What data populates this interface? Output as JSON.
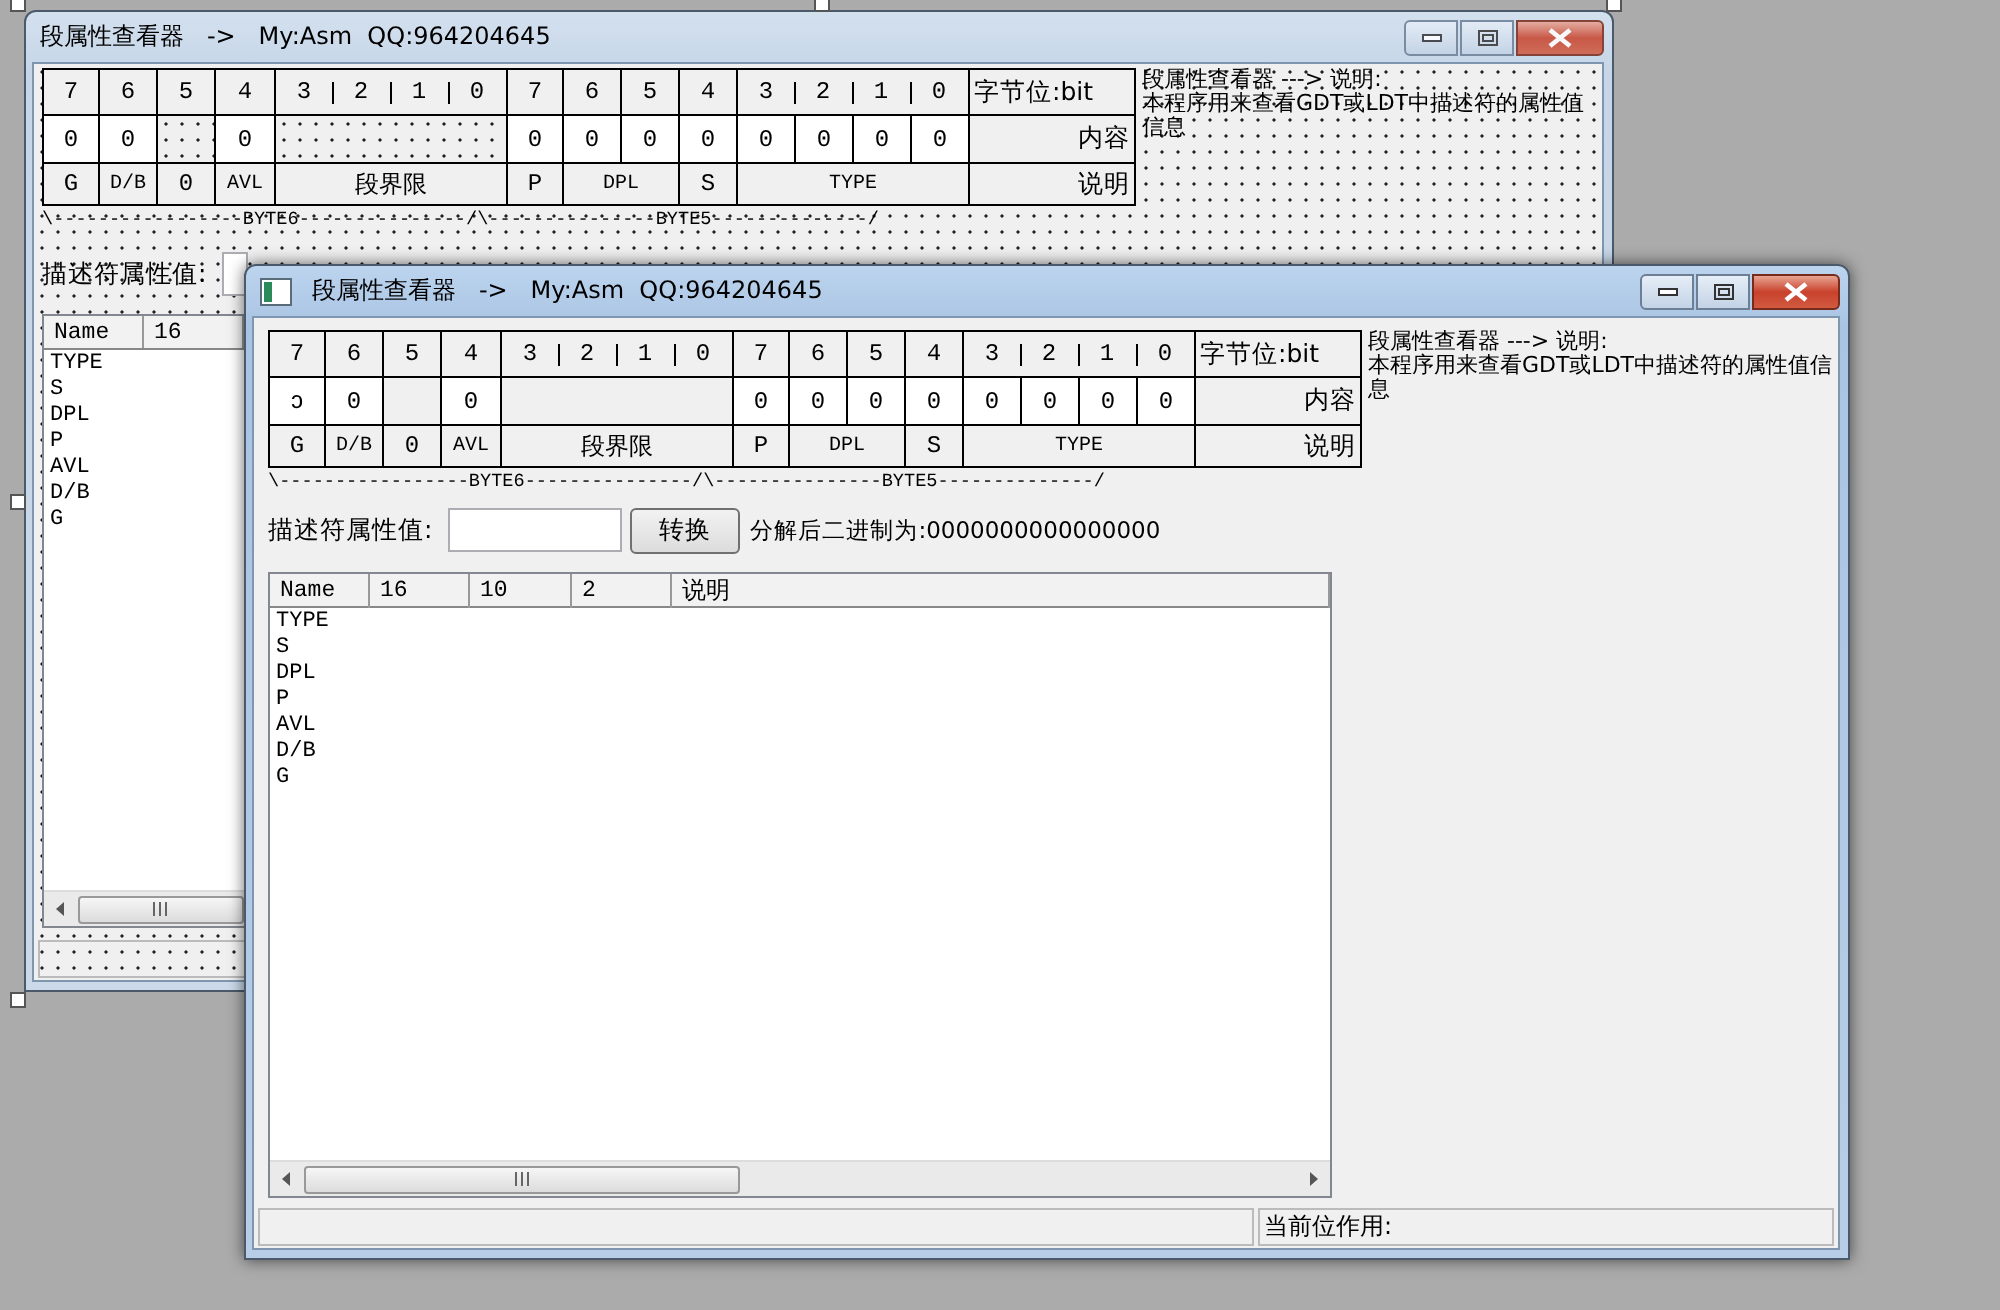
{
  "windows": [
    {
      "kind": "designer",
      "active": false,
      "title": "段属性查看器   ->   My:Asm  QQ:964204645",
      "grid": {
        "bits": [
          "7",
          "6",
          "5",
          "4",
          "3",
          "2",
          "1",
          "0",
          "7",
          "6",
          "5",
          "4",
          "3",
          "2",
          "1",
          "0"
        ],
        "bit_caption": "字节位:bit",
        "values": [
          {
            "kind": "field",
            "text": "0"
          },
          {
            "kind": "field",
            "text": "0"
          },
          {
            "kind": "blank"
          },
          {
            "kind": "field",
            "text": "0"
          },
          {
            "kind": "blank"
          },
          {
            "kind": "field",
            "text": "0"
          },
          {
            "kind": "field",
            "text": "0"
          },
          {
            "kind": "field",
            "text": "0"
          },
          {
            "kind": "field",
            "text": "0"
          },
          {
            "kind": "field",
            "text": "0"
          },
          {
            "kind": "field",
            "text": "0"
          },
          {
            "kind": "field",
            "text": "0"
          },
          {
            "kind": "field",
            "text": "0"
          }
        ],
        "value_caption": "内容",
        "fields": [
          "G",
          "D/B",
          "0",
          "AVL",
          "段界限",
          "P",
          "DPL",
          "S",
          "TYPE"
        ],
        "field_caption": "说明"
      },
      "info_heading": "段属性查看器 ---> 说明:",
      "info_text": "本程序用来查看GDT或LDT中描述符的属性值信息",
      "byte_line": "\\-----------------BYTE6---------------/\\---------------BYTE5--------------/",
      "descriptor_label": "描述符属性值:",
      "list": {
        "columns": [
          "Name",
          "16"
        ],
        "rows": [
          "TYPE",
          "S",
          "DPL",
          "P",
          "AVL",
          "D/B",
          "G"
        ]
      }
    },
    {
      "kind": "running",
      "active": true,
      "title": "段属性查看器   ->   My:Asm  QQ:964204645",
      "grid": {
        "bits": [
          "7",
          "6",
          "5",
          "4",
          "3",
          "2",
          "1",
          "0",
          "7",
          "6",
          "5",
          "4",
          "3",
          "2",
          "1",
          "0"
        ],
        "bit_caption": "字节位:bit",
        "values": [
          {
            "kind": "field",
            "text": "ↄ"
          },
          {
            "kind": "field",
            "text": "0"
          },
          {
            "kind": "blank"
          },
          {
            "kind": "field",
            "text": "0"
          },
          {
            "kind": "blank"
          },
          {
            "kind": "field",
            "text": "0"
          },
          {
            "kind": "field",
            "text": "0"
          },
          {
            "kind": "field",
            "text": "0"
          },
          {
            "kind": "field",
            "text": "0"
          },
          {
            "kind": "field",
            "text": "0"
          },
          {
            "kind": "field",
            "text": "0"
          },
          {
            "kind": "field",
            "text": "0"
          },
          {
            "kind": "field",
            "text": "0"
          }
        ],
        "value_caption": "内容",
        "fields": [
          "G",
          "D/B",
          "0",
          "AVL",
          "段界限",
          "P",
          "DPL",
          "S",
          "TYPE"
        ],
        "field_caption": "说明"
      },
      "info_heading": "段属性查看器 ---> 说明:",
      "info_text": "本程序用来查看GDT或LDT中描述符的属性值信息",
      "byte_line": "\\-----------------BYTE6---------------/\\---------------BYTE5--------------/",
      "descriptor_label": "描述符属性值:",
      "convert_button": "转换",
      "binary_output": "分解后二进制为:0000000000000000",
      "list": {
        "columns": [
          "Name",
          "16",
          "10",
          "2",
          "说明"
        ],
        "rows": [
          "TYPE",
          "S",
          "DPL",
          "P",
          "AVL",
          "D/B",
          "G"
        ]
      },
      "status_panels": [
        "当前位作用:"
      ]
    }
  ]
}
